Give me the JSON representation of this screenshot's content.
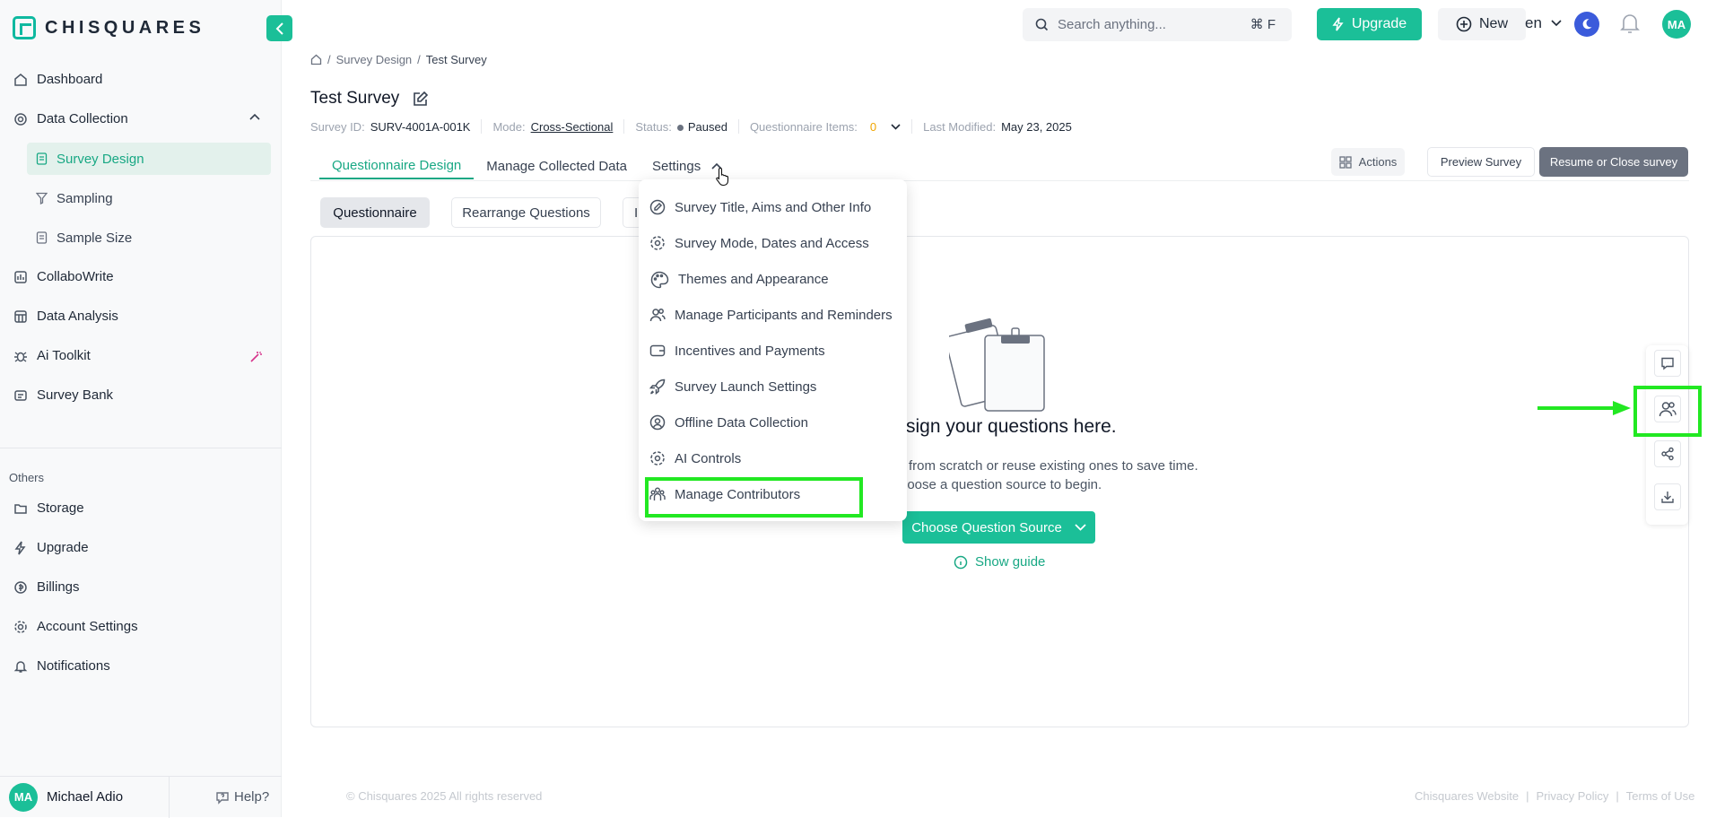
{
  "app": {
    "logo_text": "CHISQUARES"
  },
  "sidebar": {
    "items": [
      {
        "label": "Dashboard",
        "icon": "home-icon"
      },
      {
        "label": "Data Collection",
        "icon": "data-collection-icon"
      },
      {
        "label": "Survey Design",
        "icon": "file-icon"
      },
      {
        "label": "Sampling",
        "icon": "filter-icon"
      },
      {
        "label": "Sample Size",
        "icon": "file-icon"
      },
      {
        "label": "CollaboWrite",
        "icon": "collabowrite-icon"
      },
      {
        "label": "Data Analysis",
        "icon": "analysis-icon"
      },
      {
        "label": "Ai Toolkit",
        "icon": "bug-icon"
      },
      {
        "label": "Survey Bank",
        "icon": "bank-icon"
      }
    ],
    "others_label": "Others",
    "others": [
      {
        "label": "Storage",
        "icon": "folder-icon"
      },
      {
        "label": "Upgrade",
        "icon": "bolt-icon"
      },
      {
        "label": "Billings",
        "icon": "coin-icon"
      },
      {
        "label": "Account Settings",
        "icon": "gear-icon"
      },
      {
        "label": "Notifications",
        "icon": "bell-icon"
      }
    ],
    "user_initials": "MA",
    "user_name": "Michael Adio",
    "help_label": "Help?"
  },
  "topbar": {
    "search_placeholder": "Search anything...",
    "search_shortcut": "⌘ F",
    "upgrade_label": "Upgrade",
    "new_label": "New",
    "language": "en",
    "avatar_initials": "MA"
  },
  "breadcrumb": {
    "section": "Survey Design",
    "current": "Test Survey"
  },
  "survey": {
    "title": "Test Survey",
    "id_label": "Survey ID:",
    "id_value": "SURV-4001A-001K",
    "mode_label": "Mode:",
    "mode_value": "Cross-Sectional",
    "status_label": "Status:",
    "status_value": "Paused",
    "items_label": "Questionnaire Items:",
    "items_value": "0",
    "modified_label": "Last Modified:",
    "modified_value": "May 23, 2025"
  },
  "tabs": [
    "Questionnaire Design",
    "Manage Collected Data",
    "Settings"
  ],
  "header_actions": {
    "actions": "Actions",
    "preview": "Preview Survey",
    "resume": "Resume or Close survey"
  },
  "subtabs": [
    "Questionnaire",
    "Rearrange Questions",
    "I"
  ],
  "empty_state": {
    "title": "sign your questions here.",
    "line1": "from scratch or reuse existing ones to save time.",
    "line2": "hoose a question source to begin.",
    "source_button": "Choose Question Source",
    "guide": "Show guide"
  },
  "settings_menu": [
    {
      "label": "Survey Title, Aims and Other Info",
      "icon": "edit-icon"
    },
    {
      "label": "Survey Mode, Dates and Access",
      "icon": "gear-icon"
    },
    {
      "label": "Themes and Appearance",
      "icon": "palette-icon"
    },
    {
      "label": "Manage Participants and Reminders",
      "icon": "users-icon"
    },
    {
      "label": "Incentives and Payments",
      "icon": "wallet-icon"
    },
    {
      "label": "Survey Launch Settings",
      "icon": "rocket-icon"
    },
    {
      "label": "Offline Data Collection",
      "icon": "user-circle-icon"
    },
    {
      "label": "AI Controls",
      "icon": "gear-icon"
    },
    {
      "label": "Manage Contributors",
      "icon": "contributors-icon"
    }
  ],
  "footer": {
    "copyright": "© Chisquares 2025 All rights reserved",
    "links": [
      "Chisquares Website",
      "Privacy Policy",
      "Terms of Use"
    ],
    "separator": "|"
  },
  "colors": {
    "brand": "#1bbf98",
    "highlight": "#22e822"
  }
}
